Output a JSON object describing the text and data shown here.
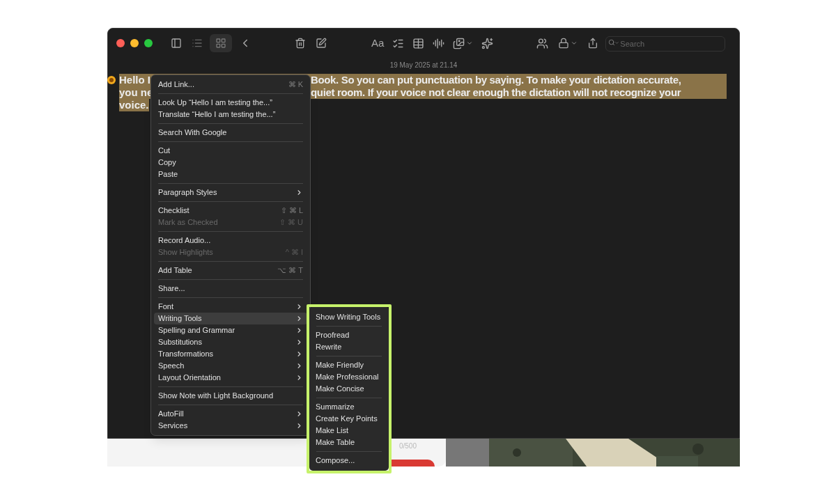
{
  "toolbar": {
    "format_label": "Aa",
    "search": {
      "placeholder": "Search"
    }
  },
  "date": "19 May 2025 at 21.14",
  "note": {
    "lines": [
      {
        "left": "Hello I",
        "right": "Book. So you can put punctuation by saying. To make your dictation accurate,"
      },
      {
        "left": "you ne",
        "right": "quiet room. If your voice not clear enough the dictation will not recognize your"
      },
      {
        "left": "voice."
      }
    ]
  },
  "context_menu": {
    "groups": [
      [
        {
          "label": "Add Link...",
          "shortcut": "⌘ K",
          "submenu": false,
          "disabled": false,
          "selected": false
        }
      ],
      [
        {
          "label": "Look Up “Hello I am testing the...”",
          "submenu": false,
          "disabled": false,
          "selected": false
        },
        {
          "label": "Translate “Hello I am testing the...”",
          "submenu": false,
          "disabled": false,
          "selected": false
        }
      ],
      [
        {
          "label": "Search With Google",
          "submenu": false,
          "disabled": false,
          "selected": false
        }
      ],
      [
        {
          "label": "Cut",
          "submenu": false,
          "disabled": false,
          "selected": false
        },
        {
          "label": "Copy",
          "submenu": false,
          "disabled": false,
          "selected": false
        },
        {
          "label": "Paste",
          "submenu": false,
          "disabled": false,
          "selected": false
        }
      ],
      [
        {
          "label": "Paragraph Styles",
          "submenu": true,
          "disabled": false,
          "selected": false
        }
      ],
      [
        {
          "label": "Checklist",
          "shortcut": "⇧ ⌘ L",
          "submenu": false,
          "disabled": false,
          "selected": false
        },
        {
          "label": "Mark as Checked",
          "shortcut": "⇧ ⌘ U",
          "submenu": false,
          "disabled": true,
          "selected": false
        }
      ],
      [
        {
          "label": "Record Audio...",
          "submenu": false,
          "disabled": false,
          "selected": false
        },
        {
          "label": "Show Highlights",
          "shortcut": "^ ⌘ I",
          "submenu": false,
          "disabled": true,
          "selected": false
        }
      ],
      [
        {
          "label": "Add Table",
          "shortcut": "⌥ ⌘ T",
          "submenu": false,
          "disabled": false,
          "selected": false
        }
      ],
      [
        {
          "label": "Share...",
          "submenu": false,
          "disabled": false,
          "selected": false
        }
      ],
      [
        {
          "label": "Font",
          "submenu": true,
          "disabled": false,
          "selected": false
        },
        {
          "label": "Writing Tools",
          "submenu": true,
          "disabled": false,
          "selected": true
        },
        {
          "label": "Spelling and Grammar",
          "submenu": true,
          "disabled": false,
          "selected": false
        },
        {
          "label": "Substitutions",
          "submenu": true,
          "disabled": false,
          "selected": false
        },
        {
          "label": "Transformations",
          "submenu": true,
          "disabled": false,
          "selected": false
        },
        {
          "label": "Speech",
          "submenu": true,
          "disabled": false,
          "selected": false
        },
        {
          "label": "Layout Orientation",
          "submenu": true,
          "disabled": false,
          "selected": false
        }
      ],
      [
        {
          "label": "Show Note with Light Background",
          "submenu": false,
          "disabled": false,
          "selected": false
        }
      ],
      [
        {
          "label": "AutoFill",
          "submenu": true,
          "disabled": false,
          "selected": false
        },
        {
          "label": "Services",
          "submenu": true,
          "disabled": false,
          "selected": false
        }
      ]
    ]
  },
  "writing_tools_menu": {
    "groups": [
      [
        "Show Writing Tools"
      ],
      [
        "Proofread",
        "Rewrite"
      ],
      [
        "Make Friendly",
        "Make Professional",
        "Make Concise"
      ],
      [
        "Summarize",
        "Create Key Points",
        "Make List",
        "Make Table"
      ],
      [
        "Compose..."
      ]
    ]
  },
  "background_window": {
    "counter": "0/500"
  }
}
